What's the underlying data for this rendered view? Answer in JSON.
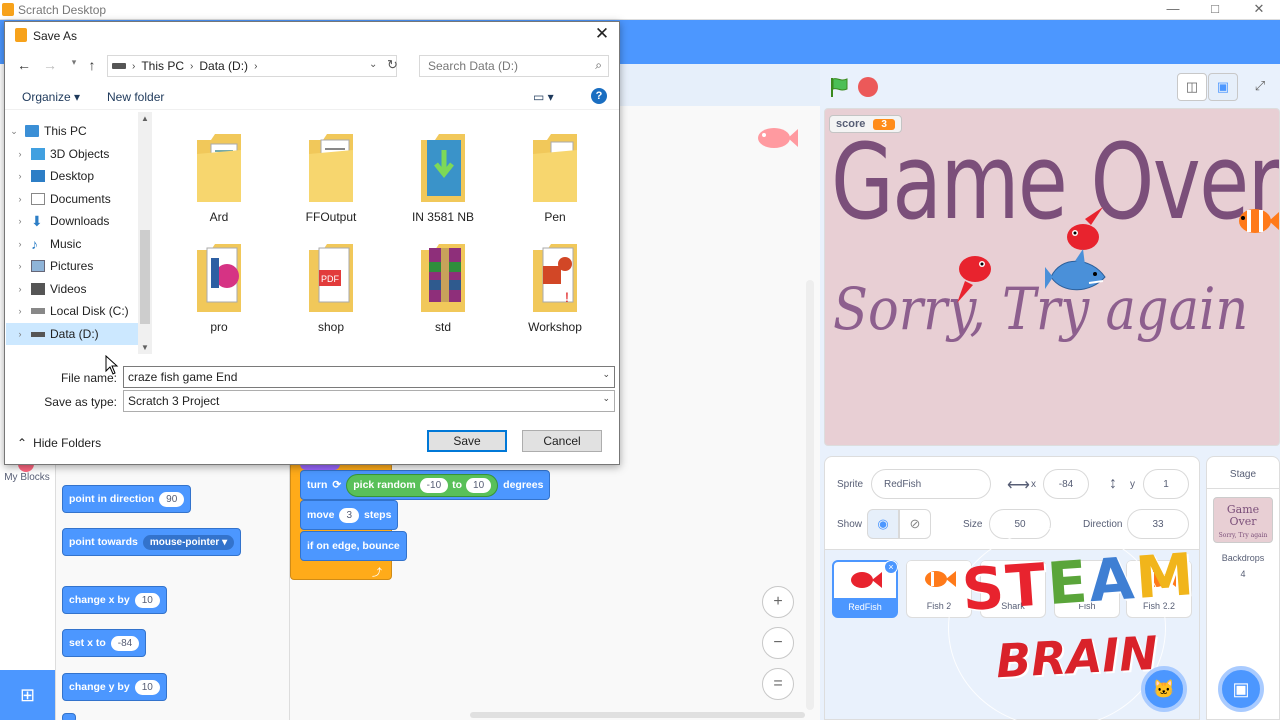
{
  "window": {
    "title": "Scratch Desktop",
    "minimize": "—",
    "maximize": "□",
    "close": "✕"
  },
  "palette": {
    "my_blocks_label": "My Blocks",
    "blocks": [
      {
        "label": "point in direction",
        "value": "90"
      },
      {
        "label": "point towards",
        "dropdown": "mouse-pointer ▾"
      },
      {
        "label": "change x by",
        "value": "10"
      },
      {
        "label": "set x to",
        "value": "-84"
      },
      {
        "label": "change y by",
        "value": "10"
      }
    ]
  },
  "script": {
    "turn": {
      "label": "turn",
      "rotate_icon": "⟳",
      "pick_random": "pick random",
      "from": "-10",
      "to_label": "to",
      "to": "10",
      "degrees": "degrees"
    },
    "move": {
      "label": "move",
      "value": "3",
      "suffix": "steps"
    },
    "bounce": "if on edge, bounce"
  },
  "zoom": {
    "in": "+",
    "out": "−",
    "reset": "="
  },
  "stage": {
    "monitor_label": "score",
    "monitor_value": "3",
    "game_over": "Game Over",
    "sorry": "Sorry, Try again"
  },
  "sprite_info": {
    "sprite_label": "Sprite",
    "sprite_name": "RedFish",
    "x_label": "x",
    "x_value": "-84",
    "y_label": "y",
    "y_value": "1",
    "show_label": "Show",
    "size_label": "Size",
    "size_value": "50",
    "direction_label": "Direction",
    "direction_value": "33"
  },
  "sprites": [
    {
      "name": "RedFish",
      "selected": true
    },
    {
      "name": "Fish 2"
    },
    {
      "name": "Shark"
    },
    {
      "name": "Fish"
    },
    {
      "name": "Fish 2.2"
    }
  ],
  "stage_pane": {
    "header": "Stage",
    "thumb_line1": "Game Over",
    "thumb_line2": "Sorry, Try again",
    "backdrops_label": "Backdrops",
    "backdrops_count": "4"
  },
  "watermark": {
    "line1": "STEAM",
    "line2": "BRAIN"
  },
  "dialog": {
    "title": "Save As",
    "path": [
      "This PC",
      "Data (D:)"
    ],
    "search_placeholder": "Search Data (D:)",
    "organize": "Organize ▾",
    "new_folder": "New folder",
    "help": "?",
    "tree": [
      {
        "label": "This PC",
        "icon": "computer-icon",
        "expanded": true
      },
      {
        "label": "3D Objects",
        "icon": "cube-folder-icon"
      },
      {
        "label": "Desktop",
        "icon": "desktop-folder-icon"
      },
      {
        "label": "Documents",
        "icon": "documents-folder-icon"
      },
      {
        "label": "Downloads",
        "icon": "download-folder-icon"
      },
      {
        "label": "Music",
        "icon": "music-folder-icon"
      },
      {
        "label": "Pictures",
        "icon": "pictures-folder-icon"
      },
      {
        "label": "Videos",
        "icon": "videos-folder-icon"
      },
      {
        "label": "Local Disk (C:)",
        "icon": "disk-icon"
      },
      {
        "label": "Data (D:)",
        "icon": "drive-icon",
        "selected": true
      }
    ],
    "files": [
      {
        "name": "Ard",
        "icon": "folder-icon"
      },
      {
        "name": "FFOutput",
        "icon": "folder-icon"
      },
      {
        "name": "IN 3581 NB",
        "icon": "download-folder-icon"
      },
      {
        "name": "Pen",
        "icon": "folder-icon"
      },
      {
        "name": "pro",
        "icon": "folder-icon"
      },
      {
        "name": "shop",
        "icon": "pdf-folder-icon"
      },
      {
        "name": "std",
        "icon": "archive-folder-icon"
      },
      {
        "name": "Workshop",
        "icon": "presentation-folder-icon"
      }
    ],
    "file_name_label": "File name:",
    "file_name_value": "craze fish game End",
    "save_type_label": "Save as type:",
    "save_type_value": "Scratch 3 Project",
    "hide_folders": "Hide Folders",
    "save": "Save",
    "cancel": "Cancel"
  },
  "colors": {
    "scratch_blue": "#4c97ff",
    "motion_block": "#4c97ff",
    "operator_green": "#59c059",
    "control_orange": "#ffab19",
    "stage_bg": "#e8cfd4",
    "title_purple": "#7b4f7a"
  }
}
